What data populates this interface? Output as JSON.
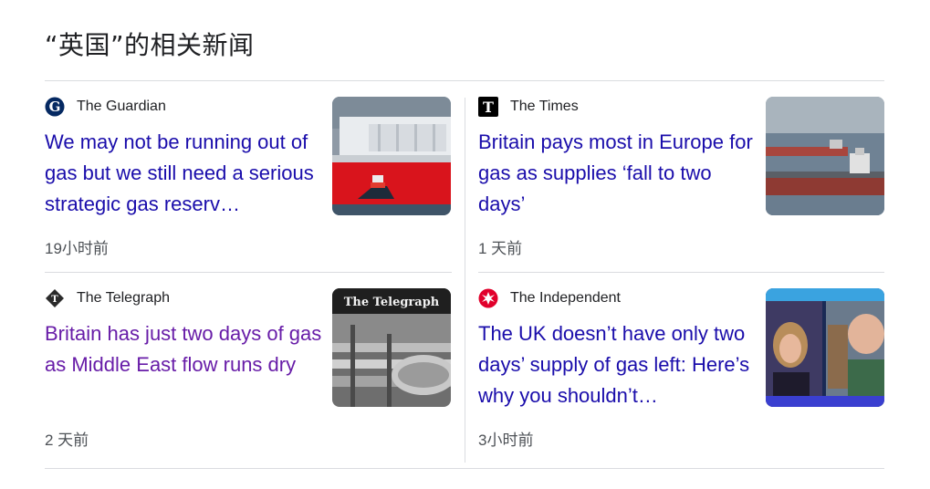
{
  "section": {
    "title": "“英国”的相关新闻"
  },
  "articles": [
    {
      "source": "The Guardian",
      "source_icon": "guardian-logo-icon",
      "headline": "We may not be running out of gas but we still need a serious strategic gas reserv…",
      "time": "19小时前"
    },
    {
      "source": "The Times",
      "source_icon": "times-logo-icon",
      "headline": "Britain pays most in Europe for gas as supplies ‘fall to two days’",
      "time": "1 天前"
    },
    {
      "source": "The Telegraph",
      "source_icon": "telegraph-logo-icon",
      "headline": "Britain has just two days of gas as Middle East flow runs dry",
      "time": "2 天前",
      "thumb_text": "The Telegraph"
    },
    {
      "source": "The Independent",
      "source_icon": "independent-logo-icon",
      "headline": "The UK doesn’t have only two days’ supply of gas left: Here’s why you shouldn’t…",
      "time": "3小时前"
    }
  ],
  "colors": {
    "link": "#1a0dab",
    "visited_link": "#681da8",
    "meta_text": "#4d5156",
    "divider": "#dadce0"
  }
}
